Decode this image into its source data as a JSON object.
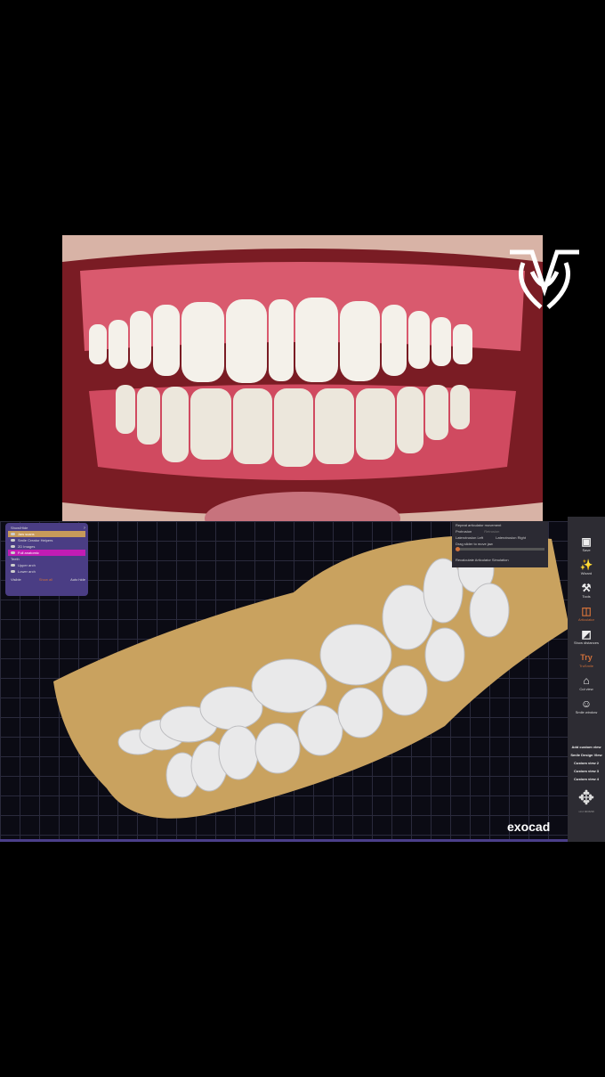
{
  "show_hide": {
    "title": "Show/Hide",
    "items": [
      {
        "label": "Jaw scans",
        "state": "highlight"
      },
      {
        "label": "Smile Creator Helpers",
        "state": "normal"
      },
      {
        "label": "2D Images",
        "state": "normal"
      },
      {
        "label": "Full anatomic",
        "state": "pink"
      }
    ],
    "teeth_title": "Teeth",
    "teeth": [
      {
        "label": "Upper arch"
      },
      {
        "label": "Lower arch"
      }
    ],
    "footer": {
      "visible": "Visible",
      "show_all": "Show all",
      "auto_hide": "Auto hide"
    }
  },
  "articulator": {
    "title": "Repeat articulator movement",
    "options": [
      "Protrusion",
      "Retrusion",
      "Laterotrusion Left",
      "Laterotrusion Right"
    ],
    "selected": "Protrusion",
    "slider_label": "Drag slider to move jaw",
    "button": "Recalculate Articulator Simulation"
  },
  "toolbar": {
    "items": [
      {
        "icon": "save-icon",
        "label": "Save"
      },
      {
        "icon": "wizard-icon",
        "label": "Wizard"
      },
      {
        "icon": "tools-icon",
        "label": "Tools"
      },
      {
        "icon": "articulator-icon",
        "label": "Articulator",
        "active": true
      },
      {
        "icon": "show-distances-icon",
        "label": "Show distances"
      },
      {
        "icon": "tryin-icon",
        "label": "TruSmile",
        "active": true
      },
      {
        "icon": "cut-view-icon",
        "label": "Cut view"
      },
      {
        "icon": "smile-window-icon",
        "label": "Smile window"
      }
    ],
    "custom_views": [
      "Add custom view",
      "Smile Design View",
      "Custom view 2",
      "Custom view 3",
      "Custom view 4"
    ],
    "version": "v3.2 9036/98"
  },
  "brand": "exocad",
  "colors": {
    "accent": "#d0703a",
    "panel": "#4a3d84",
    "highlight": "#c21cb4"
  }
}
